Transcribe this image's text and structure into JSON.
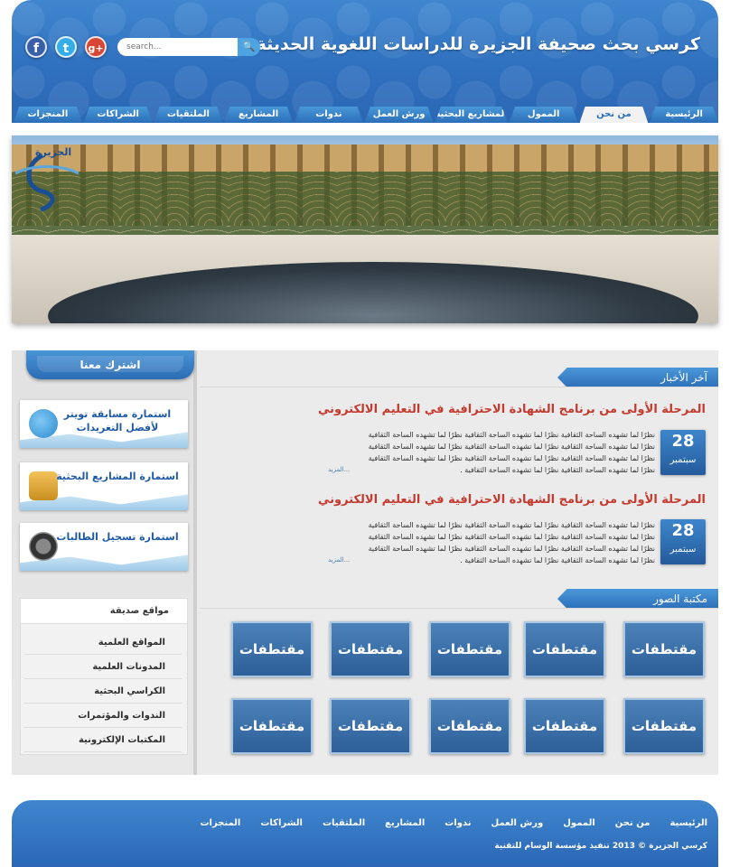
{
  "header": {
    "title": "كرسي بحث صحيفة الجزيرة للدراسات اللغوية الحديثة",
    "search_placeholder": "search...",
    "search_button": "🔍",
    "social": {
      "facebook": "f",
      "twitter": "t",
      "google_plus": "g+"
    }
  },
  "nav": {
    "tabs": [
      "الرئيسية",
      "من نحن",
      "الممول",
      "المشاريع البحثية",
      "ورش العمل",
      "ندوات",
      "المشاريع",
      "الملتقيات",
      "الشراكات",
      "المنجزات"
    ],
    "active": "من نحن"
  },
  "banner": {
    "logo_text": "الجزيرة"
  },
  "sidebar": {
    "subscribe_label": "اشترك معنا",
    "promos": [
      "استمارة مسابقة تويتر لأفضل التغريدات",
      "استمارة المشاريع البحثية",
      "استمارة تسجيل الطالبات"
    ],
    "friends_title": "مواقع صديقة",
    "friends_links": [
      "المواقع العلمية",
      "المدونات العلمية",
      "الكراسي البحثية",
      "الندوات والمؤتمرات",
      "المكتبات الإلكترونية"
    ]
  },
  "news": {
    "heading": "آخر الأخبار",
    "items": [
      {
        "title": "المرحلة الأولى من برنامج الشهادة الاحترافية في التعليم الالكتروني",
        "day": "28",
        "month": "سبتمبر",
        "lines": [
          "نظرًا لما تشهده الساحة الثقافية  نظرًا لما تشهده الساحة الثقافية  نظرًا لما تشهده الساحة الثقافية",
          "نظرًا لما تشهده الساحة الثقافية  نظرًا لما تشهده الساحة الثقافية  نظرًا لما تشهده الساحة الثقافية",
          "نظرًا لما تشهده الساحة الثقافية  نظرًا لما تشهده الساحة الثقافية  نظرًا لما تشهده الساحة الثقافية",
          "نظرًا لما تشهده الساحة الثقافية  نظرًا لما تشهده الساحة الثقافية ."
        ],
        "more": "المزيد..."
      },
      {
        "title": "المرحلة الأولى من برنامج الشهادة الاحترافية في التعليم الالكتروني",
        "day": "28",
        "month": "سبتمبر",
        "lines": [
          "نظرًا لما تشهده الساحة الثقافية  نظرًا لما تشهده الساحة الثقافية  نظرًا لما تشهده الساحة الثقافية",
          "نظرًا لما تشهده الساحة الثقافية  نظرًا لما تشهده الساحة الثقافية  نظرًا لما تشهده الساحة الثقافية",
          "نظرًا لما تشهده الساحة الثقافية  نظرًا لما تشهده الساحة الثقافية  نظرًا لما تشهده الساحة الثقافية",
          "نظرًا لما تشهده الساحة الثقافية  نظرًا لما تشهده الساحة الثقافية ."
        ],
        "more": "المزيد..."
      }
    ]
  },
  "gallery": {
    "heading": "مكتبة الصور",
    "thumb_label": "مقتطفات"
  },
  "footer": {
    "links": [
      "الرئيسية",
      "من نحن",
      "الممول",
      "ورش العمل",
      "ندوات",
      "المشاريع",
      "الملتقيات",
      "الشراكات",
      "المنجزات"
    ],
    "copyright": "كرسي الجزيرة © 2013    تنفيذ مؤسسة الوسام للتقنية"
  },
  "colors": {
    "brand_blue": "#2f70bf",
    "news_title_red": "#c43a2e",
    "page_bg": "#ebebeb"
  }
}
